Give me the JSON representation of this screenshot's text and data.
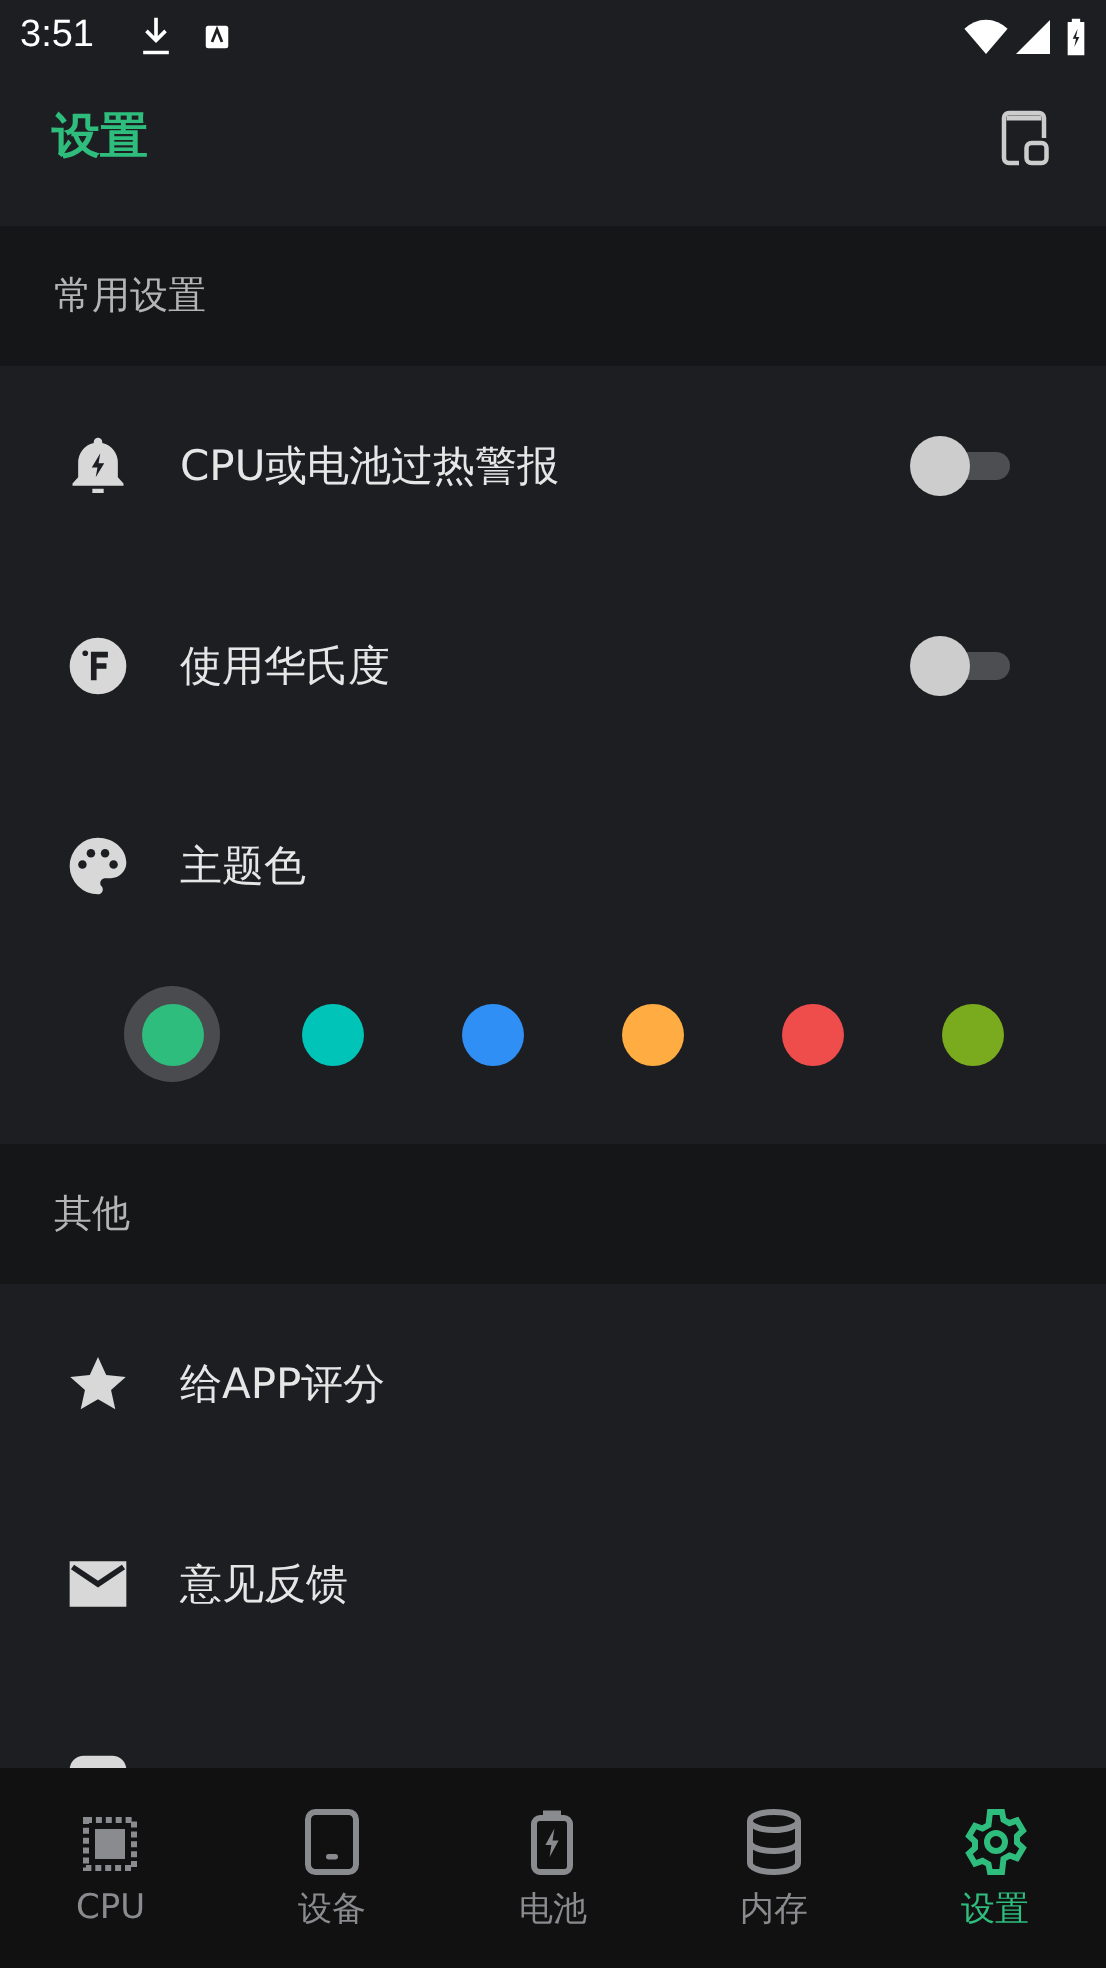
{
  "status_bar": {
    "time": "3:51"
  },
  "app_bar": {
    "title": "设置"
  },
  "sections": [
    {
      "title": "常用设置",
      "items": [
        {
          "kind": "toggle",
          "label": "CPU或电池过热警报",
          "on": false
        },
        {
          "kind": "toggle",
          "label": "使用华氏度",
          "on": false
        },
        {
          "kind": "colors",
          "label": "主题色",
          "colors": [
            {
              "color": "#2ebd7d",
              "selected": true
            },
            {
              "color": "#00c4b8",
              "selected": false
            },
            {
              "color": "#2f8ff5",
              "selected": false
            },
            {
              "color": "#ffad42",
              "selected": false
            },
            {
              "color": "#ef4c4c",
              "selected": false
            },
            {
              "color": "#7aab1f",
              "selected": false
            }
          ]
        }
      ]
    },
    {
      "title": "其他",
      "items": [
        {
          "kind": "link",
          "label": "给APP评分"
        },
        {
          "kind": "link",
          "label": "意见反馈"
        },
        {
          "kind": "link"
        }
      ]
    }
  ],
  "bottom_nav": [
    {
      "label": "CPU",
      "selected": false
    },
    {
      "label": "设备",
      "selected": false
    },
    {
      "label": "电池",
      "selected": false
    },
    {
      "label": "内存",
      "selected": false
    },
    {
      "label": "设置",
      "selected": true
    }
  ]
}
